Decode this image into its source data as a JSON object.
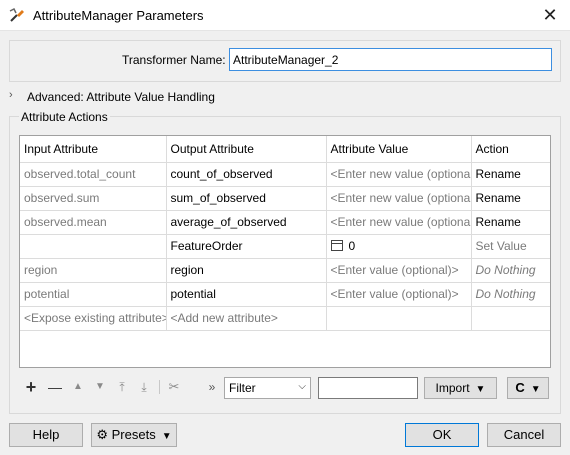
{
  "window": {
    "title": "AttributeManager Parameters",
    "close_icon": "close-icon",
    "app_icon": "fme-transformer-icon"
  },
  "transformer_name": {
    "label": "Transformer Name:",
    "value": "AttributeManager_2"
  },
  "advanced": {
    "label": "Advanced: Attribute Value Handling",
    "icon": "chevron-right-icon"
  },
  "attribute_actions": {
    "title": "Attribute Actions",
    "columns": [
      "Input Attribute",
      "Output Attribute",
      "Attribute Value",
      "Action"
    ],
    "rows": [
      {
        "input": "observed.total_count",
        "output": "count_of_observed",
        "value": "<Enter new value (optional)>",
        "action": "Rename"
      },
      {
        "input": "observed.sum",
        "output": "sum_of_observed",
        "value": "<Enter new value (optional)>",
        "action": "Rename"
      },
      {
        "input": "observed.mean",
        "output": "average_of_observed",
        "value": "<Enter new value (optional)>",
        "action": "Rename"
      },
      {
        "input": "",
        "output": "FeatureOrder",
        "value": "0",
        "action": "Set Value"
      },
      {
        "input": "region",
        "output": "region",
        "value": "<Enter value (optional)>",
        "action": "Do Nothing"
      },
      {
        "input": "potential",
        "output": "potential",
        "value": "<Enter value (optional)>",
        "action": "Do Nothing"
      },
      {
        "input": "<Expose existing attribute>",
        "output": "<Add new attribute>",
        "value": "",
        "action": ""
      }
    ]
  },
  "toolbar": {
    "add": "+",
    "remove": "—",
    "move_up": "▲",
    "move_down": "▼",
    "move_top": "⤒",
    "move_bottom": "⤓",
    "cut": "✂",
    "more": "»",
    "filter_value": "Filter",
    "filter_text": "",
    "import_label": "Import",
    "refresh": "C"
  },
  "footer": {
    "help": "Help",
    "presets": "Presets",
    "ok": "OK",
    "cancel": "Cancel"
  }
}
